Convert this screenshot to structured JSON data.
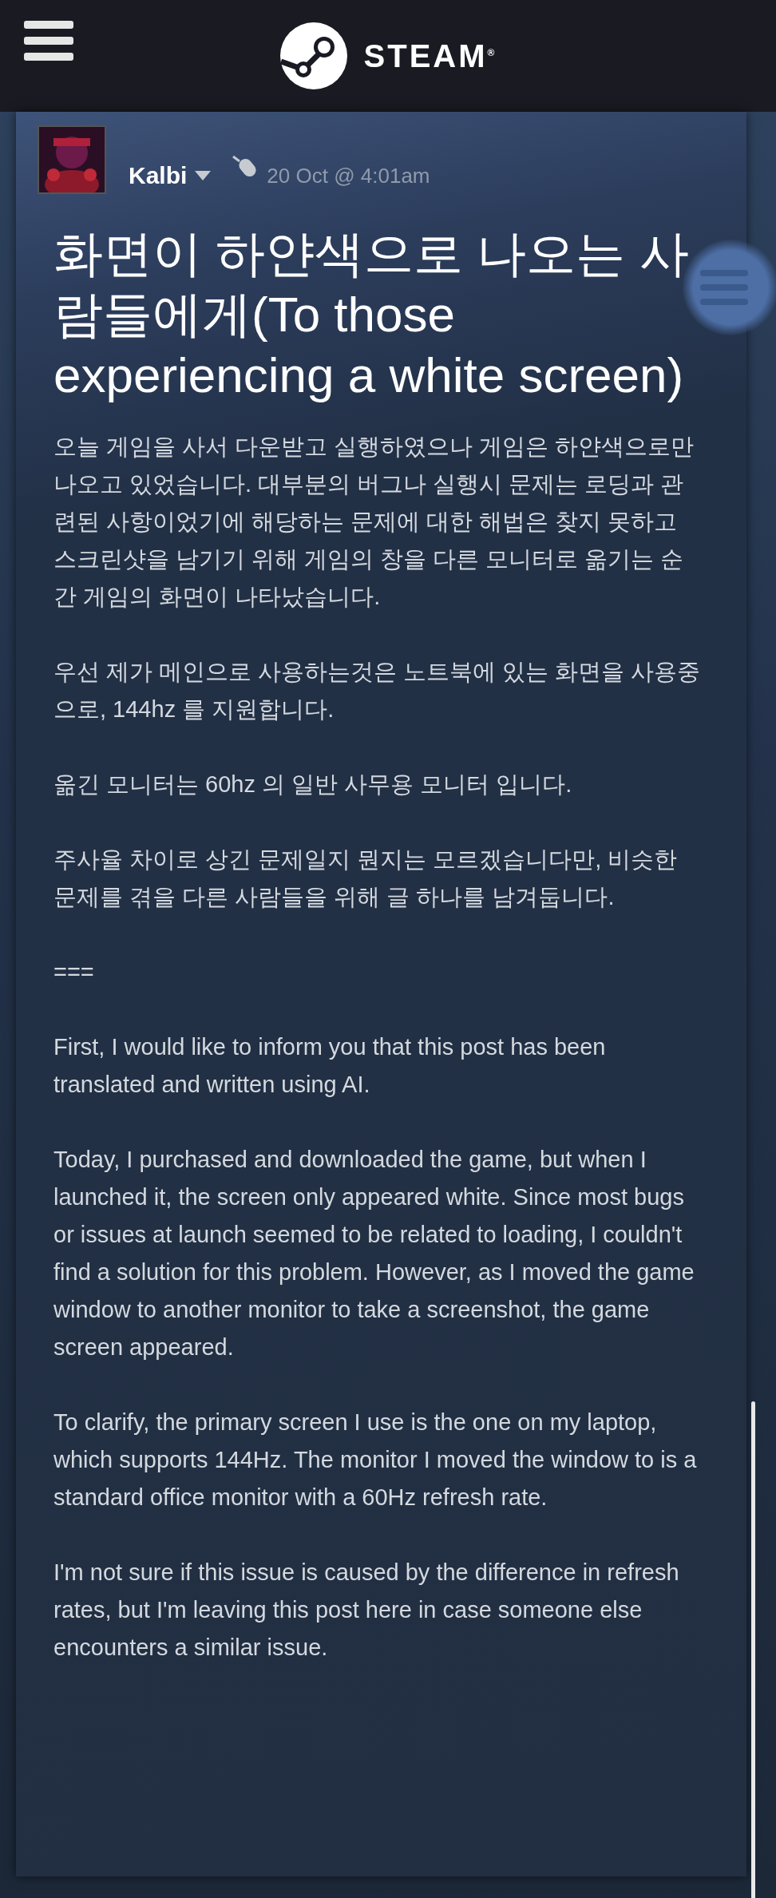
{
  "header": {
    "logo_text": "STEAM",
    "logo_mark": "®"
  },
  "post": {
    "author": "Kalbi",
    "posted": "20 Oct @ 4:01am",
    "title": "화면이 하얀색으로 나오는 사람들에게(To those experiencing a white screen)",
    "paragraphs": [
      "오늘 게임을 사서 다운받고 실행하였으나 게임은 하얀색으로만 나오고 있었습니다. 대부분의 버그나 실행시 문제는 로딩과 관련된 사항이었기에 해당하는 문제에 대한 해법은 찾지 못하고 스크린샷을 남기기 위해 게임의 창을 다른 모니터로 옮기는 순간 게임의 화면이 나타났습니다.",
      "우선 제가 메인으로 사용하는것은 노트북에 있는 화면을 사용중으로, 144hz 를 지원합니다.",
      "옮긴 모니터는 60hz 의 일반 사무용 모니터 입니다.",
      "주사율 차이로 상긴 문제일지 뭔지는 모르겠습니다만, 비슷한 문제를 겪을 다른 사람들을 위해 글 하나를 남겨둡니다.",
      "===",
      "First, I would like to inform you that this post has been translated and written using AI.",
      "Today, I purchased and downloaded the game, but when I launched it, the screen only appeared white. Since most bugs or issues at launch seemed to be related to loading, I couldn't find a solution for this problem. However, as I moved the game window to another monitor to take a screenshot, the game screen appeared.",
      "To clarify, the primary screen I use is the one on my laptop, which supports 144Hz. The monitor I moved the window to is a standard office monitor with a 60Hz refresh rate.",
      "I'm not sure if this issue is caused by the difference in refresh rates, but I'm leaving this post here in case someone else encounters a similar issue."
    ]
  }
}
